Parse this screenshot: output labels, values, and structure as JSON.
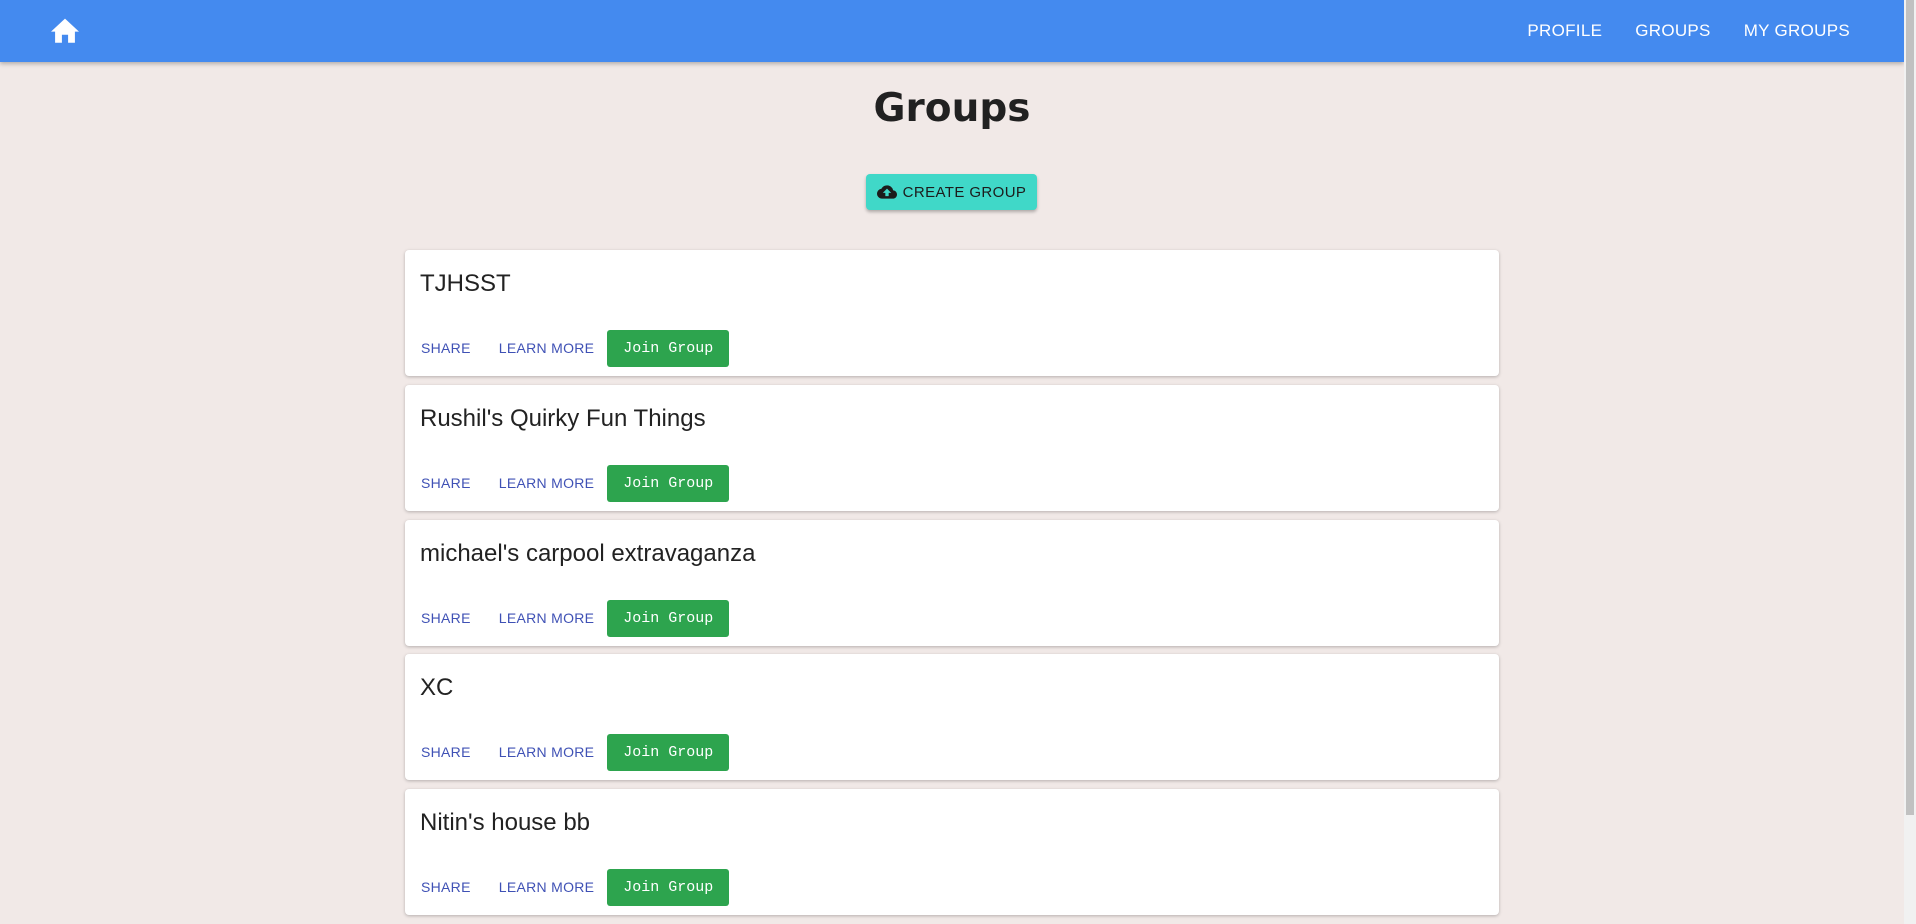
{
  "appbar": {
    "home_icon": "home-icon",
    "nav": [
      "PROFILE",
      "GROUPS",
      "MY GROUPS"
    ]
  },
  "page": {
    "title": "Groups"
  },
  "create_button": {
    "icon": "cloud-upload-icon",
    "label": "CREATE GROUP"
  },
  "groups": [
    {
      "name": "TJHSST",
      "share": "SHARE",
      "learn_more": "LEARN MORE",
      "join": "Join Group"
    },
    {
      "name": "Rushil's Quirky Fun Things",
      "share": "SHARE",
      "learn_more": "LEARN MORE",
      "join": "Join Group"
    },
    {
      "name": "michael's carpool extravaganza",
      "share": "SHARE",
      "learn_more": "LEARN MORE",
      "join": "Join Group"
    },
    {
      "name": "XC",
      "share": "SHARE",
      "learn_more": "LEARN MORE",
      "join": "Join Group"
    },
    {
      "name": "Nitin's house bb",
      "share": "SHARE",
      "learn_more": "LEARN MORE",
      "join": "Join Group"
    }
  ],
  "colors": {
    "appbar": "#448aef",
    "background": "#f1e9e7",
    "create_button": "#40d8c8",
    "join_button": "#2da44e",
    "text_button": "#3f51b5"
  }
}
